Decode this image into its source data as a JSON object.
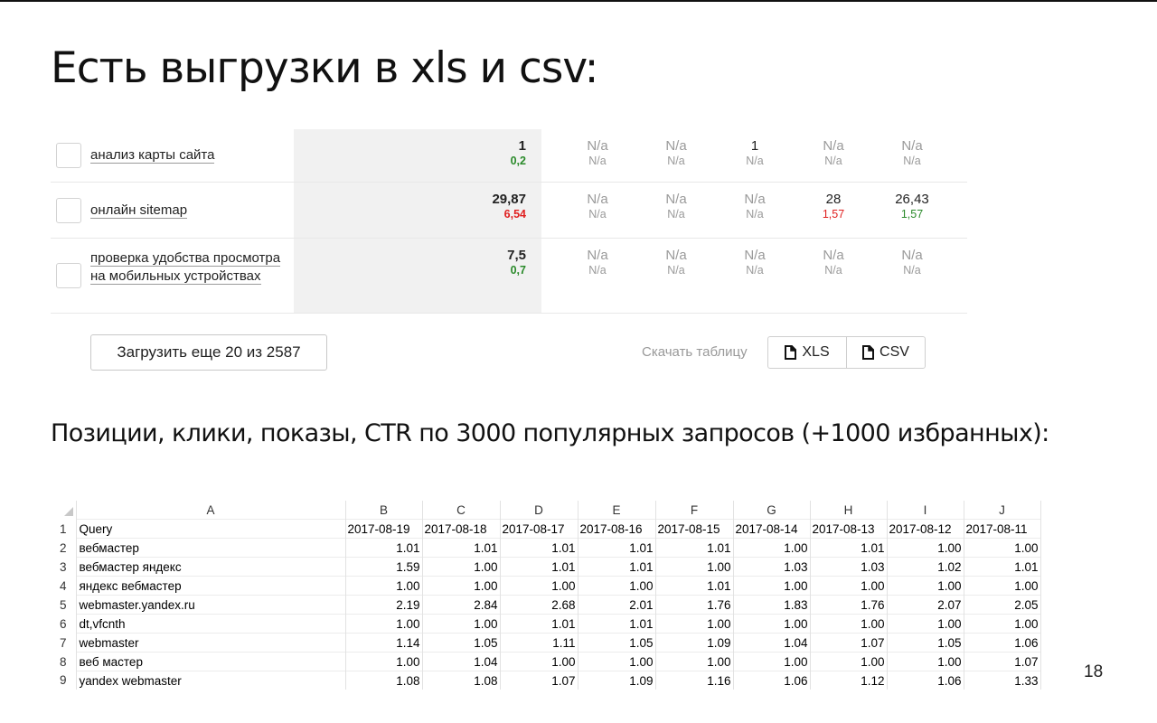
{
  "title": "Есть выгрузки в xls и csv:",
  "queries": [
    {
      "label": "анализ карты сайта",
      "main": {
        "value": "1",
        "delta": "0,2",
        "delta_color": "green"
      },
      "cols": [
        {
          "value": "N/a",
          "delta": "N/a",
          "delta_color": "gray"
        },
        {
          "value": "N/a",
          "delta": "N/a",
          "delta_color": "gray"
        },
        {
          "value": "1",
          "delta": "N/a",
          "delta_color": "gray"
        },
        {
          "value": "N/a",
          "delta": "N/a",
          "delta_color": "gray"
        },
        {
          "value": "N/a",
          "delta": "N/a",
          "delta_color": "gray"
        }
      ]
    },
    {
      "label": "онлайн sitemap",
      "main": {
        "value": "29,87",
        "delta": "6,54",
        "delta_color": "red"
      },
      "cols": [
        {
          "value": "N/a",
          "delta": "N/a",
          "delta_color": "gray"
        },
        {
          "value": "N/a",
          "delta": "N/a",
          "delta_color": "gray"
        },
        {
          "value": "N/a",
          "delta": "N/a",
          "delta_color": "gray"
        },
        {
          "value": "28",
          "delta": "1,57",
          "delta_color": "red"
        },
        {
          "value": "26,43",
          "delta": "1,57",
          "delta_color": "green"
        }
      ]
    },
    {
      "label": "проверка удобства просмотра на мобильных устройствах",
      "main": {
        "value": "7,5",
        "delta": "0,7",
        "delta_color": "green"
      },
      "cols": [
        {
          "value": "N/a",
          "delta": "N/a",
          "delta_color": "gray"
        },
        {
          "value": "N/a",
          "delta": "N/a",
          "delta_color": "gray"
        },
        {
          "value": "N/a",
          "delta": "N/a",
          "delta_color": "gray"
        },
        {
          "value": "N/a",
          "delta": "N/a",
          "delta_color": "gray"
        },
        {
          "value": "N/a",
          "delta": "N/a",
          "delta_color": "gray"
        }
      ]
    }
  ],
  "load_more_label": "Загрузить еще 20 из 2587",
  "download": {
    "label": "Скачать таблицу",
    "xls": "XLS",
    "csv": "CSV"
  },
  "subtitle": "Позиции, клики, показы, CTR по 3000 популярных запросов (+1000 избранных):",
  "spreadsheet": {
    "columns": [
      "A",
      "B",
      "C",
      "D",
      "E",
      "F",
      "G",
      "H",
      "I",
      "J"
    ],
    "header": [
      "Query",
      "2017-08-19",
      "2017-08-18",
      "2017-08-17",
      "2017-08-16",
      "2017-08-15",
      "2017-08-14",
      "2017-08-13",
      "2017-08-12",
      "2017-08-11"
    ],
    "rows": [
      {
        "query": "вебмастер",
        "values": [
          "1.01",
          "1.01",
          "1.01",
          "1.01",
          "1.01",
          "1.00",
          "1.01",
          "1.00",
          "1.00"
        ]
      },
      {
        "query": "вебмастер яндекс",
        "values": [
          "1.59",
          "1.00",
          "1.01",
          "1.01",
          "1.00",
          "1.03",
          "1.03",
          "1.02",
          "1.01"
        ]
      },
      {
        "query": "яндекс вебмастер",
        "values": [
          "1.00",
          "1.00",
          "1.00",
          "1.00",
          "1.01",
          "1.00",
          "1.00",
          "1.00",
          "1.00"
        ]
      },
      {
        "query": "webmaster.yandex.ru",
        "values": [
          "2.19",
          "2.84",
          "2.68",
          "2.01",
          "1.76",
          "1.83",
          "1.76",
          "2.07",
          "2.05"
        ]
      },
      {
        "query": "dt,vfcnth",
        "values": [
          "1.00",
          "1.00",
          "1.01",
          "1.01",
          "1.00",
          "1.00",
          "1.00",
          "1.00",
          "1.00"
        ]
      },
      {
        "query": "webmaster",
        "values": [
          "1.14",
          "1.05",
          "1.11",
          "1.05",
          "1.09",
          "1.04",
          "1.07",
          "1.05",
          "1.06"
        ]
      },
      {
        "query": "веб мастер",
        "values": [
          "1.00",
          "1.04",
          "1.00",
          "1.00",
          "1.00",
          "1.00",
          "1.00",
          "1.00",
          "1.07"
        ]
      },
      {
        "query": "yandex webmaster",
        "values": [
          "1.08",
          "1.08",
          "1.07",
          "1.09",
          "1.16",
          "1.06",
          "1.12",
          "1.06",
          "1.33"
        ]
      }
    ]
  },
  "page_number": "18",
  "colors": {
    "green": "#2a8a2a",
    "red": "#e02020",
    "gray": "#9a9a9a",
    "highlight": "#f1f1f1"
  },
  "icons": {
    "file": "file-icon",
    "select_all": "corner-triangle-icon"
  }
}
